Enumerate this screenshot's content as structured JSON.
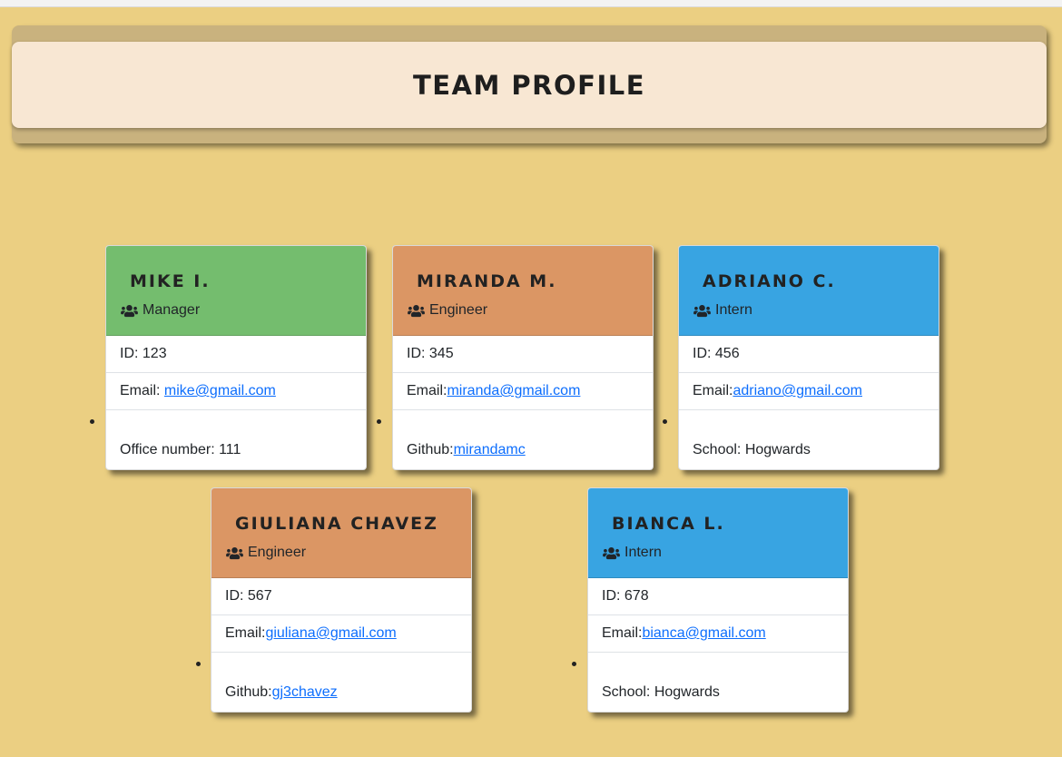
{
  "header": {
    "title": "TEAM PROFILE"
  },
  "colors": {
    "manager": "#74bd6e",
    "engineer": "#db9664",
    "intern": "#38a4e2"
  },
  "members": [
    {
      "name": "MIKE I.",
      "role": "Manager",
      "icon": "users-icon",
      "id_text": "ID: 123",
      "email_label": "Email: ",
      "email": "mike@gmail.com",
      "extra_label": "Office number: 111",
      "extra_link": ""
    },
    {
      "name": "MIRANDA M.",
      "role": "Engineer",
      "icon": "users-icon",
      "id_text": "ID: 345",
      "email_label": "Email:",
      "email": "miranda@gmail.com",
      "extra_label": "Github:",
      "extra_link": "mirandamc"
    },
    {
      "name": "ADRIANO C.",
      "role": "Intern",
      "icon": "users-icon",
      "id_text": "ID: 456",
      "email_label": "Email:",
      "email": "adriano@gmail.com",
      "extra_label": "School: Hogwards",
      "extra_link": ""
    },
    {
      "name": "GIULIANA CHAVEZ",
      "role": "Engineer",
      "icon": "users-icon",
      "id_text": "ID: 567",
      "email_label": "Email:",
      "email": "giuliana@gmail.com",
      "extra_label": "Github:",
      "extra_link": "gj3chavez"
    },
    {
      "name": "BIANCA L.",
      "role": "Intern",
      "icon": "users-icon",
      "id_text": "ID: 678",
      "email_label": "Email:",
      "email": "bianca@gmail.com",
      "extra_label": "School: Hogwards",
      "extra_link": ""
    }
  ]
}
